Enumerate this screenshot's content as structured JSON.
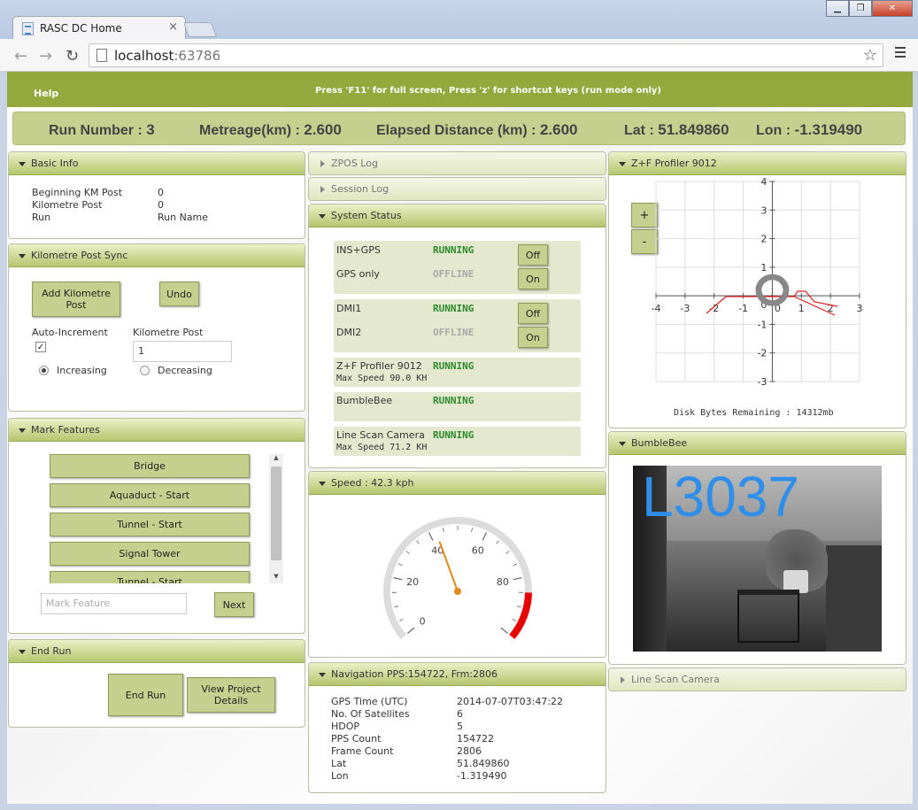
{
  "browser": {
    "tab_title": "RASC DC Home",
    "url_host": "localhost",
    "url_port": ":63786"
  },
  "header": {
    "help_label": "Help",
    "hint": "Press 'F11' for full screen, Press 'z' for shortcut keys (run mode only)"
  },
  "runbar": {
    "run_number_label": "Run Number :",
    "run_number": "3",
    "metreage_label": "Metreage(km) :",
    "metreage": "2.600",
    "elapsed_label": "Elapsed Distance (km) :",
    "elapsed": "2.600",
    "lat_label": "Lat :",
    "lat": "51.849860",
    "lon_label": "Lon :",
    "lon": "-1.319490"
  },
  "basic_info": {
    "title": "Basic Info",
    "rows": [
      {
        "label": "Beginning KM Post",
        "value": "0"
      },
      {
        "label": "Kilometre Post",
        "value": "0"
      },
      {
        "label": "Run",
        "value": "Run Name"
      }
    ]
  },
  "km_sync": {
    "title": "Kilometre Post Sync",
    "add_label": "Add Kilometre Post",
    "undo_label": "Undo",
    "auto_increment_label": "Auto-Increment",
    "auto_increment_checked": true,
    "km_post_label": "Kilometre Post",
    "km_post_value": "1",
    "increasing_label": "Increasing",
    "decreasing_label": "Decreasing"
  },
  "mark_features": {
    "title": "Mark Features",
    "items": [
      "Bridge",
      "Aquaduct - Start",
      "Tunnel - Start",
      "Signal Tower",
      "Tunnel - Start"
    ],
    "input_placeholder": "Mark Feature",
    "next_label": "Next"
  },
  "end_run": {
    "title": "End Run",
    "end_label": "End Run",
    "view_label": "View Project Details"
  },
  "zpos_log": {
    "title": "ZPOS Log"
  },
  "session_log": {
    "title": "Session Log"
  },
  "system_status": {
    "title": "System Status",
    "ins_label": "INS+GPS",
    "ins_status": "RUNNING",
    "gps_label": "GPS only",
    "gps_status": "OFFLINE",
    "off_label": "Off",
    "on_label": "On",
    "dmi1_label": "DMI1",
    "dmi1_status": "RUNNING",
    "dmi2_label": "DMI2",
    "dmi2_status": "OFFLINE",
    "zf_label": "Z+F Profiler 9012",
    "zf_status": "RUNNING",
    "zf_speed": "Max Speed 90.0 KH",
    "bb_label": "BumbleBee",
    "bb_status": "RUNNING",
    "lsc_label": "Line Scan Camera",
    "lsc_status": "RUNNING",
    "lsc_speed": "Max Speed 71.2 KH"
  },
  "speed": {
    "title": "Speed  : 42.3 kph",
    "value": 42.3,
    "ticks": [
      "0",
      "20",
      "40",
      "60",
      "80"
    ]
  },
  "navigation": {
    "title": "Navigation PPS:154722, Frm:2806",
    "rows": [
      {
        "label": "GPS Time (UTC)",
        "value": "2014-07-07T03:47:22"
      },
      {
        "label": "No. Of Satellites",
        "value": "6"
      },
      {
        "label": "HDOP",
        "value": "5"
      },
      {
        "label": "PPS Count",
        "value": "154722"
      },
      {
        "label": "Frame Count",
        "value": "2806"
      },
      {
        "label": "Lat",
        "value": "51.849860"
      },
      {
        "label": "Lon",
        "value": "-1.319490"
      }
    ]
  },
  "profiler": {
    "title": "Z+F Profiler 9012",
    "zoom_in": "+",
    "zoom_out": "-",
    "disk": "Disk Bytes Remaining : 14312mb",
    "x_ticks": [
      "-4",
      "-3",
      "-2",
      "-1",
      "0",
      "1",
      "2",
      "3"
    ],
    "y_ticks": [
      "4",
      "3",
      "2",
      "1",
      "0",
      "-1",
      "-2",
      "-3"
    ]
  },
  "bumblebee": {
    "title": "BumbleBee",
    "overlay_text": "L3037"
  },
  "line_scan": {
    "title": "Line Scan Camera"
  }
}
